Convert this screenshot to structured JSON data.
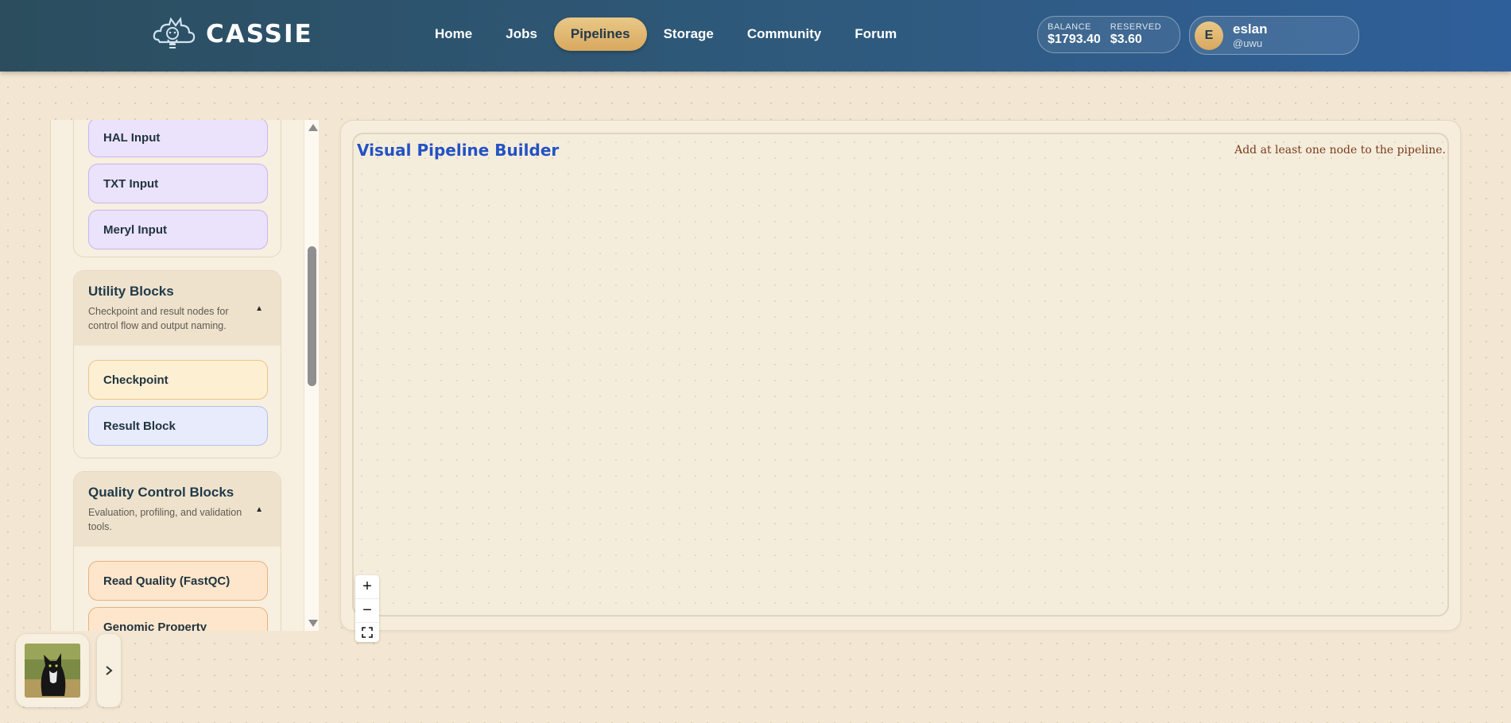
{
  "brand": {
    "name": "CASSIE"
  },
  "nav": {
    "items": [
      {
        "label": "Home"
      },
      {
        "label": "Jobs"
      },
      {
        "label": "Pipelines"
      },
      {
        "label": "Storage"
      },
      {
        "label": "Community"
      },
      {
        "label": "Forum"
      }
    ],
    "active": "Pipelines"
  },
  "account": {
    "balance_label": "BALANCE",
    "balance_value": "$1793.40",
    "reserved_label": "RESERVED",
    "reserved_value": "$3.60"
  },
  "user": {
    "initial": "E",
    "name": "eslan",
    "handle": "@uwu"
  },
  "sidebar": {
    "input_blocks": [
      {
        "label": "HAL Input"
      },
      {
        "label": "TXT Input"
      },
      {
        "label": "Meryl Input"
      }
    ],
    "utility": {
      "title": "Utility Blocks",
      "description": "Checkpoint and result nodes for control flow and output naming.",
      "blocks": [
        {
          "label": "Checkpoint"
        },
        {
          "label": "Result Block"
        }
      ]
    },
    "quality": {
      "title": "Quality Control Blocks",
      "description": "Evaluation, profiling, and validation tools.",
      "blocks": [
        {
          "label": "Read Quality (FastQC)"
        },
        {
          "label": "Genomic Property"
        }
      ]
    }
  },
  "canvas": {
    "title": "Visual Pipeline Builder",
    "message": "Add at least one node to the pipeline.",
    "zoom_in": "+",
    "zoom_out": "−"
  },
  "colors": {
    "header_start": "#2b4d5e",
    "header_end": "#2f5f9a",
    "nav_active": "#e0b873",
    "title_blue": "#2352c4",
    "warning_text": "#7a3b1d"
  },
  "icons": [
    "cat-logo-icon",
    "collapse-up-icon",
    "zoom-in-icon",
    "zoom-out-icon",
    "fit-view-icon",
    "chevron-right-icon"
  ]
}
